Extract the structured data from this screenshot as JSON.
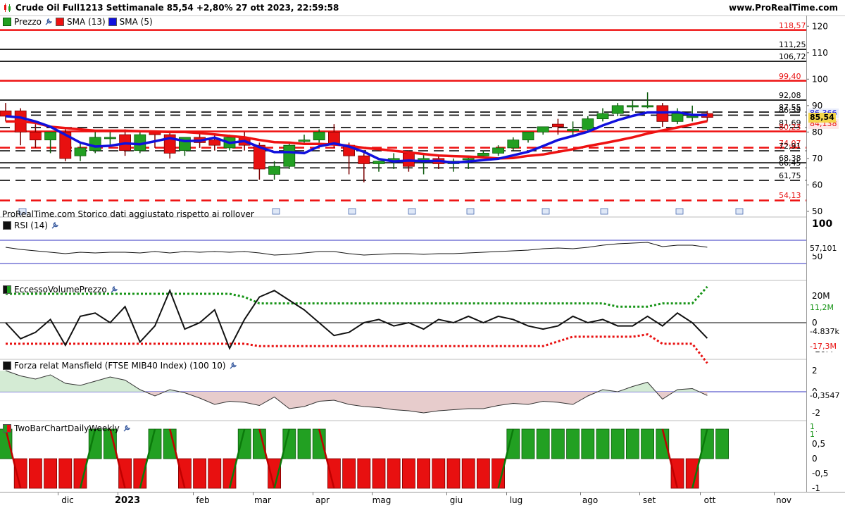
{
  "header": {
    "title": "Crude Oil Full1213 Settimanale 85,54 +2,80% 27 ott 2023, 22:59:58",
    "site": "www.ProRealTime.com"
  },
  "colors": {
    "up": "#22a022",
    "down": "#e81010",
    "sma13": "#ee1111",
    "sma5": "#1010dd",
    "level_red": "#ee1111",
    "level_black": "#000000"
  },
  "legend": {
    "price": "Prezzo",
    "sma13": "SMA (13)",
    "sma5": "SMA (5)"
  },
  "watermark": "ProRealTime.com  Storico dati aggiustato rispetto ai rollover",
  "price_panel": {
    "y_ticks": [
      "120",
      "110",
      "100",
      "90",
      "80",
      "70",
      "60",
      "50"
    ],
    "levels": [
      {
        "label": "118,57",
        "value": 118.57,
        "color": "red",
        "style": "solid"
      },
      {
        "label": "111,25",
        "value": 111.25,
        "color": "black",
        "style": "solid"
      },
      {
        "label": "106,72",
        "value": 106.72,
        "color": "black",
        "style": "solid"
      },
      {
        "label": "99,40",
        "value": 99.4,
        "color": "red",
        "style": "solid"
      },
      {
        "label": "92,08",
        "value": 92.08,
        "color": "black",
        "style": "solid"
      },
      {
        "label": "87,55",
        "value": 87.55,
        "color": "black",
        "style": "dashed"
      },
      {
        "label": "86,39",
        "value": 86.39,
        "color": "black",
        "style": "dashed"
      },
      {
        "label": "81,69",
        "value": 81.69,
        "color": "black",
        "style": "dashed"
      },
      {
        "label": "80,23",
        "value": 80.23,
        "color": "red",
        "style": "solid"
      },
      {
        "label": "74,07",
        "value": 74.07,
        "color": "red",
        "style": "dashed"
      },
      {
        "label": "72,91",
        "value": 72.91,
        "color": "black",
        "style": "dashed"
      },
      {
        "label": "68,38",
        "value": 68.38,
        "color": "black",
        "style": "solid"
      },
      {
        "label": "66,45",
        "value": 66.45,
        "color": "black",
        "style": "dashed"
      },
      {
        "label": "61,75",
        "value": 61.75,
        "color": "black",
        "style": "dashed"
      },
      {
        "label": "54,13",
        "value": 54.13,
        "color": "red",
        "style": "dashed"
      }
    ],
    "price_tag": "85,54",
    "sma5_tag": "86,366",
    "sma13_tag": "84,138"
  },
  "rsi_panel": {
    "label": "RSI (14)",
    "ticks": [
      "100",
      "50"
    ],
    "value_tag": "57,101"
  },
  "evp_panel": {
    "label": "EccessoVolumePrezzo",
    "ticks": [
      "20M",
      "0",
      "-20M"
    ],
    "upper_tag": "11,2M",
    "value_tag": "-4.837k",
    "lower_tag": "-17,3M"
  },
  "mansfield_panel": {
    "label": "Forza relat Mansfield (FTSE MIB40 Index) (100 10)",
    "ticks": [
      "2",
      "0",
      "-2"
    ],
    "value_tag": "-0,3547"
  },
  "twobar_panel": {
    "label": "TwoBarChartDailyWeekly",
    "ticks": [
      "1",
      "0,5",
      "0",
      "-0,5",
      "-1"
    ],
    "value_tag_top": "1",
    "value_tag_bot": "1"
  },
  "x_axis": {
    "labels": [
      "dic",
      "2023",
      "feb",
      "mar",
      "apr",
      "mag",
      "giu",
      "lug",
      "ago",
      "set",
      "ott",
      "nov"
    ]
  },
  "chart_data": {
    "type": "candlestick",
    "timeframe": "weekly",
    "y_range": [
      50,
      123
    ],
    "series": [
      {
        "name": "Prezzo",
        "ohlc": [
          [
            88,
            91,
            84,
            86
          ],
          [
            88,
            89,
            75,
            80
          ],
          [
            80,
            83,
            74,
            77
          ],
          [
            77,
            80,
            72,
            80
          ],
          [
            80,
            81,
            69,
            70
          ],
          [
            71,
            76,
            69,
            74
          ],
          [
            73,
            80,
            72,
            78
          ],
          [
            78,
            80,
            75,
            78
          ],
          [
            79,
            81,
            71,
            73
          ],
          [
            73,
            80,
            72,
            79
          ],
          [
            80,
            80,
            74,
            79
          ],
          [
            79,
            80,
            70,
            72
          ],
          [
            73,
            78,
            71,
            78
          ],
          [
            78,
            80,
            74,
            76
          ],
          [
            77,
            79,
            73,
            75
          ],
          [
            74,
            79,
            73,
            78
          ],
          [
            78,
            80,
            73,
            75
          ],
          [
            75,
            76,
            62,
            66
          ],
          [
            64,
            69,
            62,
            67
          ],
          [
            67,
            76,
            66,
            75
          ],
          [
            77,
            79,
            76,
            77
          ],
          [
            77,
            81,
            76,
            80
          ],
          [
            80,
            83,
            74,
            75
          ],
          [
            75,
            76,
            64,
            71
          ],
          [
            71,
            72,
            61,
            68
          ],
          [
            68,
            69,
            65,
            69
          ],
          [
            69,
            72,
            66,
            70
          ],
          [
            72,
            73,
            65,
            67
          ],
          [
            69,
            72,
            64,
            70
          ],
          [
            70,
            71,
            66,
            68
          ],
          [
            68,
            70,
            65,
            69
          ],
          [
            70,
            71,
            66,
            70
          ],
          [
            71,
            73,
            70,
            72
          ],
          [
            72,
            75,
            71,
            74
          ],
          [
            74,
            78,
            73,
            77
          ],
          [
            77,
            80,
            76,
            80
          ],
          [
            80,
            82,
            79,
            82
          ],
          [
            83,
            85,
            79,
            82
          ],
          [
            81,
            84,
            78,
            81
          ],
          [
            81,
            86,
            80,
            85
          ],
          [
            85,
            89,
            84,
            87
          ],
          [
            87,
            91,
            86,
            90
          ],
          [
            90,
            92,
            88,
            90
          ],
          [
            90,
            95,
            89,
            90
          ],
          [
            90,
            91,
            82,
            84
          ],
          [
            84,
            89,
            83,
            87
          ],
          [
            86,
            90,
            84,
            86
          ],
          [
            87,
            88,
            84,
            85.54
          ]
        ]
      },
      {
        "name": "SMA (13)",
        "values": [
          84,
          84,
          83.5,
          82,
          81.5,
          81,
          80.5,
          80.5,
          80.5,
          80.3,
          80.2,
          80,
          80,
          79.6,
          79.1,
          78.5,
          78,
          77,
          76.2,
          76,
          75.5,
          75.5,
          75.3,
          74.8,
          74,
          73.5,
          72.9,
          72.3,
          71.7,
          71.1,
          70.9,
          70.7,
          70.4,
          70,
          70.2,
          71,
          71.5,
          72.5,
          73.5,
          74.7,
          75.7,
          76.8,
          78,
          79.4,
          80.6,
          81.7,
          82.9,
          84.138
        ]
      },
      {
        "name": "SMA (5)",
        "values": [
          86,
          85.5,
          84,
          82,
          79,
          76,
          74.5,
          74.8,
          75.7,
          75.4,
          76.5,
          77.7,
          76.6,
          76.7,
          77.9,
          75.9,
          76.6,
          74.3,
          72.4,
          72.4,
          72,
          74.6,
          75.7,
          74.5,
          72.5,
          69.8,
          68.9,
          69.2,
          69,
          69.1,
          68.4,
          68.9,
          69.4,
          69.9,
          71.2,
          72.5,
          74.7,
          77,
          78.5,
          80.1,
          82.5,
          84.5,
          86.1,
          87.4,
          87.4,
          87.5,
          86.5,
          86.366
        ]
      }
    ],
    "indicators": {
      "RSI (14)": [
        57,
        54,
        52,
        50,
        48,
        50,
        49,
        50,
        50,
        49,
        51,
        49,
        51,
        50,
        51,
        50,
        51,
        49,
        46,
        47,
        49,
        51,
        51,
        48,
        46,
        47,
        48,
        48,
        47,
        48,
        48,
        49,
        50,
        51,
        52,
        53,
        55,
        56,
        55,
        57,
        60,
        62,
        63,
        64,
        58,
        60,
        60,
        57.101
      ],
      "EccessoVolumePrezzo": {
        "value": [
          0,
          -5,
          -3,
          1,
          -7,
          2,
          3,
          0,
          5,
          -6,
          -1,
          10,
          -2,
          0,
          4,
          -8,
          1,
          8,
          10,
          7,
          4,
          0,
          -4,
          -3,
          0,
          1,
          -1,
          0,
          -2,
          1,
          0,
          2,
          0,
          2,
          1,
          -1,
          -2,
          -1,
          2,
          0,
          1,
          -1,
          -1,
          2,
          -1,
          3,
          0,
          -4.837
        ],
        "upper": [
          9,
          9,
          9,
          9,
          9,
          9,
          9,
          9,
          9,
          9,
          9,
          9,
          9,
          9,
          9,
          9,
          8,
          6,
          6,
          6,
          6,
          6,
          6,
          6,
          6,
          6,
          6,
          6,
          6,
          6,
          6,
          6,
          6,
          6,
          6,
          6,
          6,
          6,
          6,
          6,
          6,
          5,
          5,
          5,
          6,
          6,
          6,
          11.2
        ],
        "lower": [
          -9,
          -9,
          -9,
          -9,
          -9,
          -9,
          -9,
          -9,
          -9,
          -9,
          -9,
          -9,
          -9,
          -9,
          -9,
          -9,
          -9,
          -10,
          -10,
          -10,
          -10,
          -10,
          -10,
          -10,
          -10,
          -10,
          -10,
          -10,
          -10,
          -10,
          -10,
          -10,
          -10,
          -10,
          -10,
          -10,
          -10,
          -8,
          -6,
          -6,
          -6,
          -6,
          -6,
          -5,
          -9,
          -9,
          -9,
          -17.3
        ]
      },
      "Mansfield": [
        2,
        1.5,
        1.2,
        1.6,
        0.8,
        0.6,
        1,
        1.4,
        1.1,
        0.2,
        -0.4,
        0.2,
        -0.1,
        -0.6,
        -1.2,
        -0.9,
        -1,
        -1.3,
        -0.5,
        -1.6,
        -1.4,
        -0.9,
        -0.8,
        -1.2,
        -1.4,
        -1.5,
        -1.7,
        -1.8,
        -2,
        -1.8,
        -1.7,
        -1.6,
        -1.6,
        -1.3,
        -1.1,
        -1.2,
        -0.9,
        -1,
        -1.2,
        -0.4,
        0.2,
        0,
        0.5,
        0.9,
        -0.7,
        0.2,
        0.3,
        -0.3547
      ],
      "TwoBarChartDailyWeekly": [
        1,
        -1,
        -1,
        -1,
        -1,
        -1,
        1,
        1,
        -1,
        -1,
        1,
        1,
        -1,
        -1,
        -1,
        -1,
        1,
        1,
        -1,
        1,
        1,
        1,
        -1,
        -1,
        -1,
        -1,
        -1,
        -1,
        -1,
        -1,
        -1,
        -1,
        -1,
        -1,
        1,
        1,
        1,
        1,
        1,
        1,
        1,
        1,
        1,
        1,
        1,
        -1,
        -1,
        1,
        1
      ]
    }
  }
}
